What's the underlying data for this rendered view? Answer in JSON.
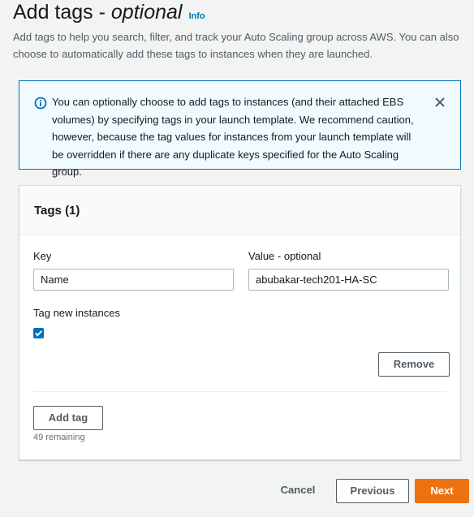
{
  "header": {
    "title_prefix": "Add tags - ",
    "title_suffix": "optional",
    "info_label": "Info",
    "description": "Add tags to help you search, filter, and track your Auto Scaling group across AWS. You can also choose to automatically add these tags to instances when they are launched."
  },
  "alert": {
    "text": "You can optionally choose to add tags to instances (and their attached EBS volumes) by specifying tags in your launch template. We recommend caution, however, because the tag values for instances from your launch template will be overridden if there are any duplicate keys specified for the Auto Scaling group.",
    "icon": "info-icon",
    "close_icon": "close-icon"
  },
  "tags_panel": {
    "title": "Tags (1)",
    "key_label": "Key",
    "value_label": "Value - optional",
    "key_value": "Name",
    "value_value": "abubakar-tech201-HA-SC",
    "tag_new_instances_label": "Tag new instances",
    "tag_new_instances_checked": true,
    "remove_label": "Remove",
    "add_tag_label": "Add tag",
    "remaining_text": "49 remaining"
  },
  "footer": {
    "cancel_label": "Cancel",
    "previous_label": "Previous",
    "next_label": "Next"
  },
  "colors": {
    "accent": "#0073bb",
    "primary_button": "#ec7211",
    "alert_background": "#f1faff"
  }
}
